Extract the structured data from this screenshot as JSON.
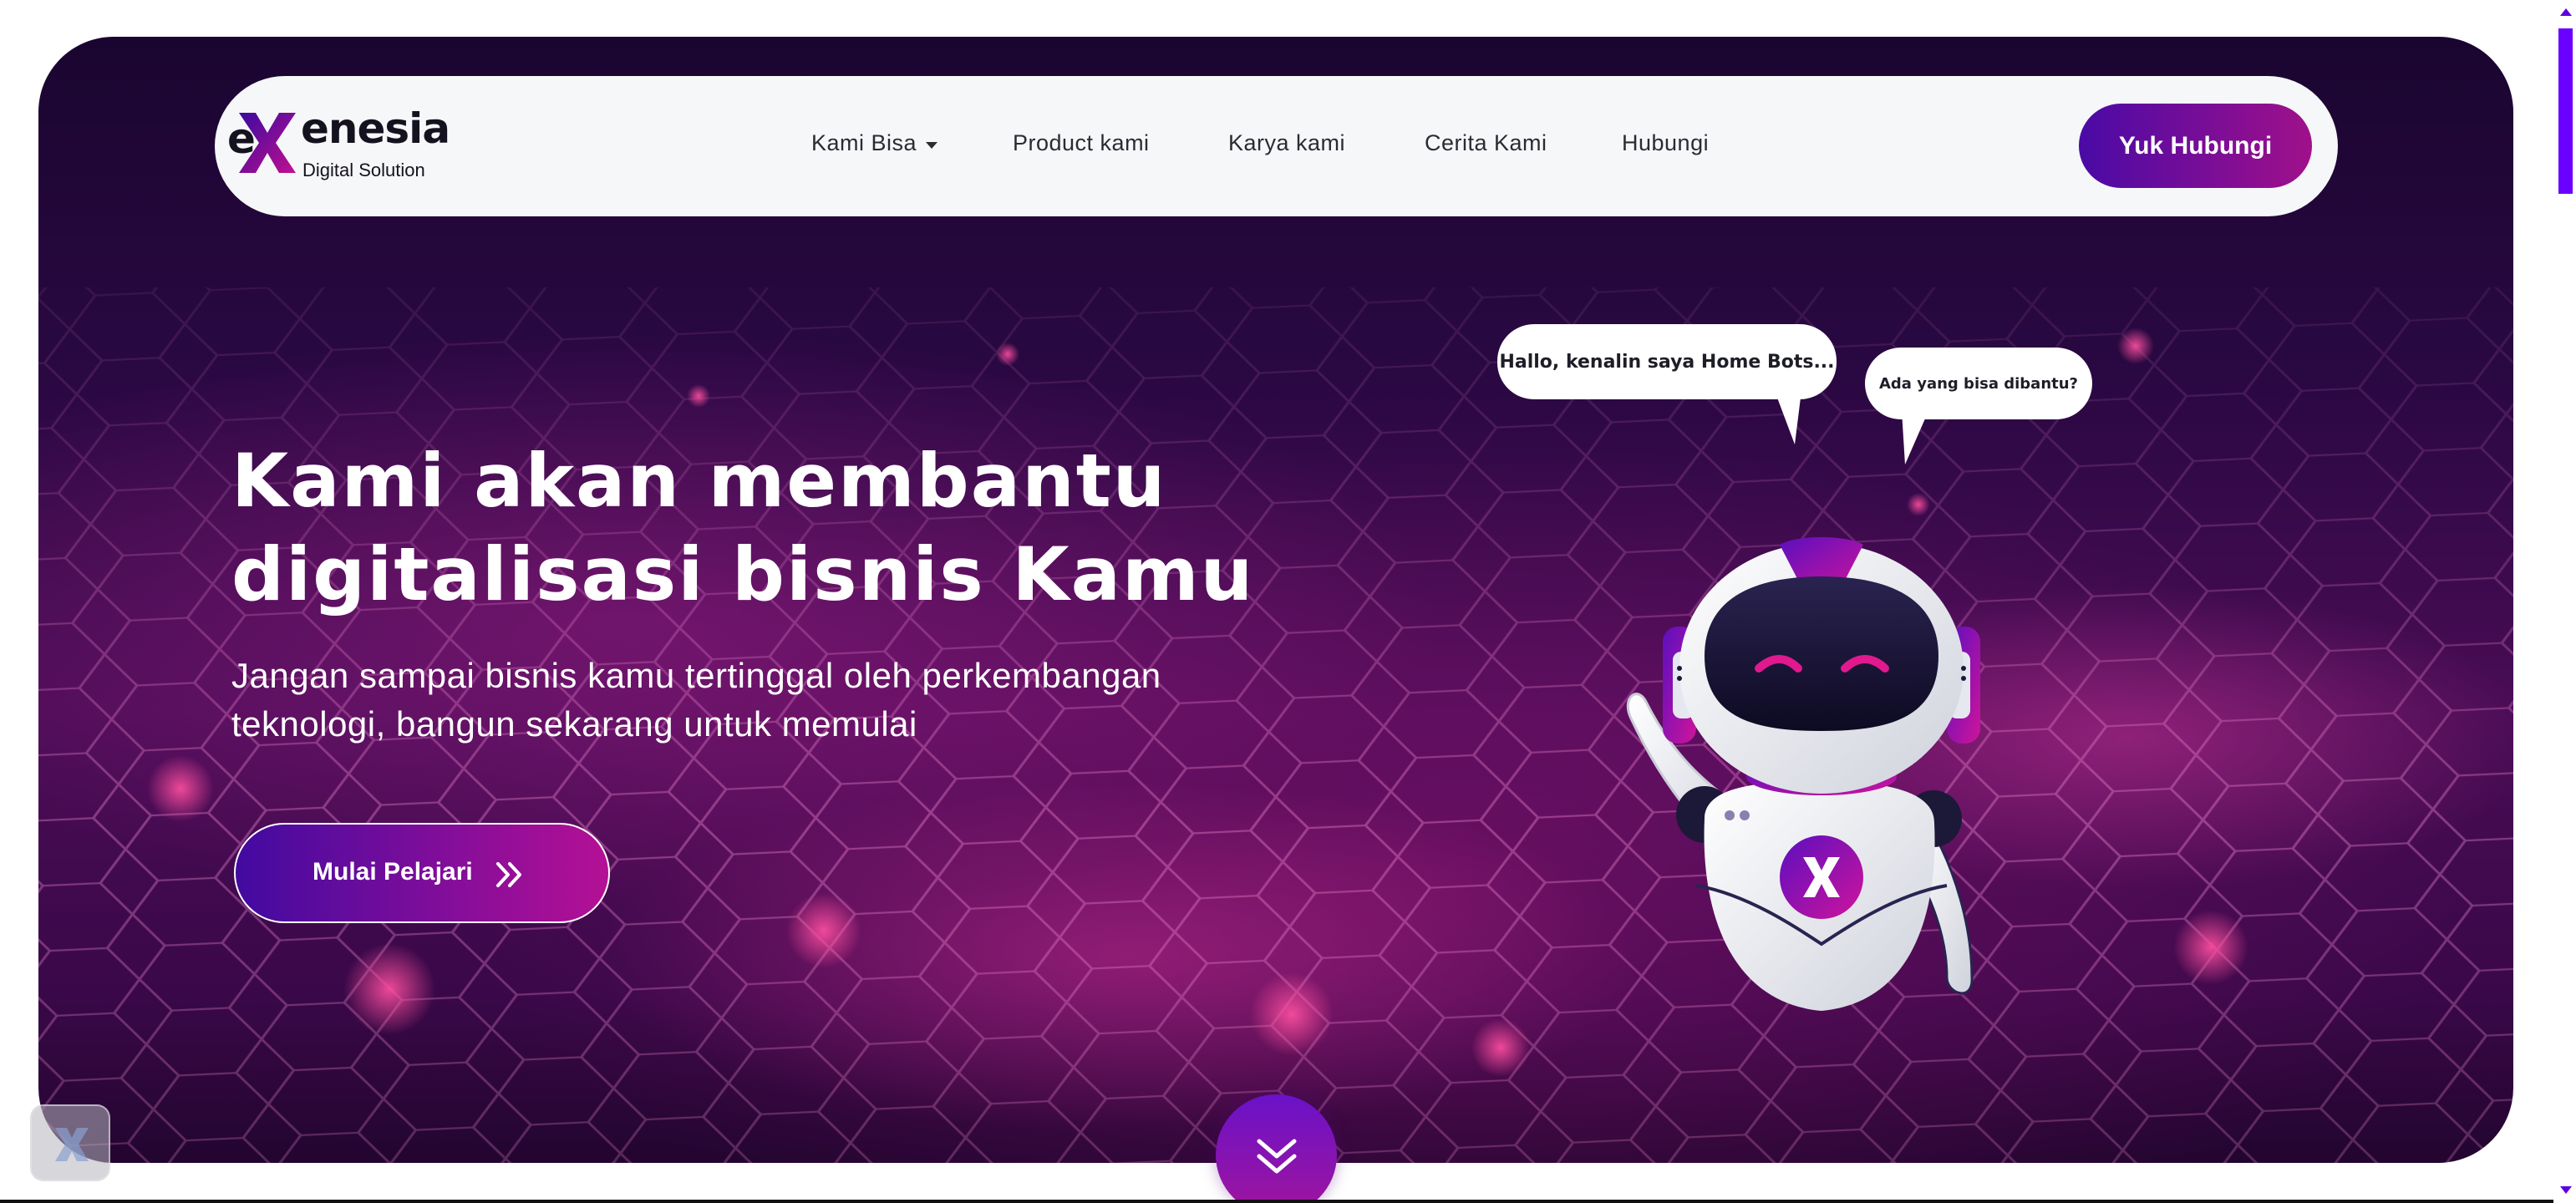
{
  "brand": {
    "name": "eXenesia",
    "name_prefix": "e",
    "name_suffix": "enesia",
    "tagline": "Digital Solution"
  },
  "nav": {
    "items": [
      {
        "label": "Kami Bisa",
        "has_dropdown": true
      },
      {
        "label": "Product kami"
      },
      {
        "label": "Karya kami"
      },
      {
        "label": "Cerita Kami"
      },
      {
        "label": "Hubungi"
      }
    ],
    "cta_label": "Yuk Hubungi"
  },
  "hero": {
    "headline_line1": "Kami akan membantu",
    "headline_line2": "digitalisasi bisnis Kamu",
    "subtitle_line1": "Jangan sampai bisnis kamu tertinggal oleh perkembangan",
    "subtitle_line2": "teknologi, bangun sekarang untuk memulai",
    "cta_label": "Mulai Pelajari",
    "cta_icon": "double-chevron-right-icon"
  },
  "bot": {
    "bubble1": "Hallo, kenalin saya Home Bots...",
    "bubble2": "Ada yang bisa dibantu?"
  },
  "icons": {
    "scroll_down": "double-chevron-down-icon",
    "corner_widget": "exenesia-x-icon"
  },
  "colors": {
    "accent_purple": "#4a0aa6",
    "accent_magenta": "#b41095",
    "hero_dark": "#1a0530",
    "navbar_bg": "#f6f7f8",
    "scrollbar": "#6a00ff"
  }
}
